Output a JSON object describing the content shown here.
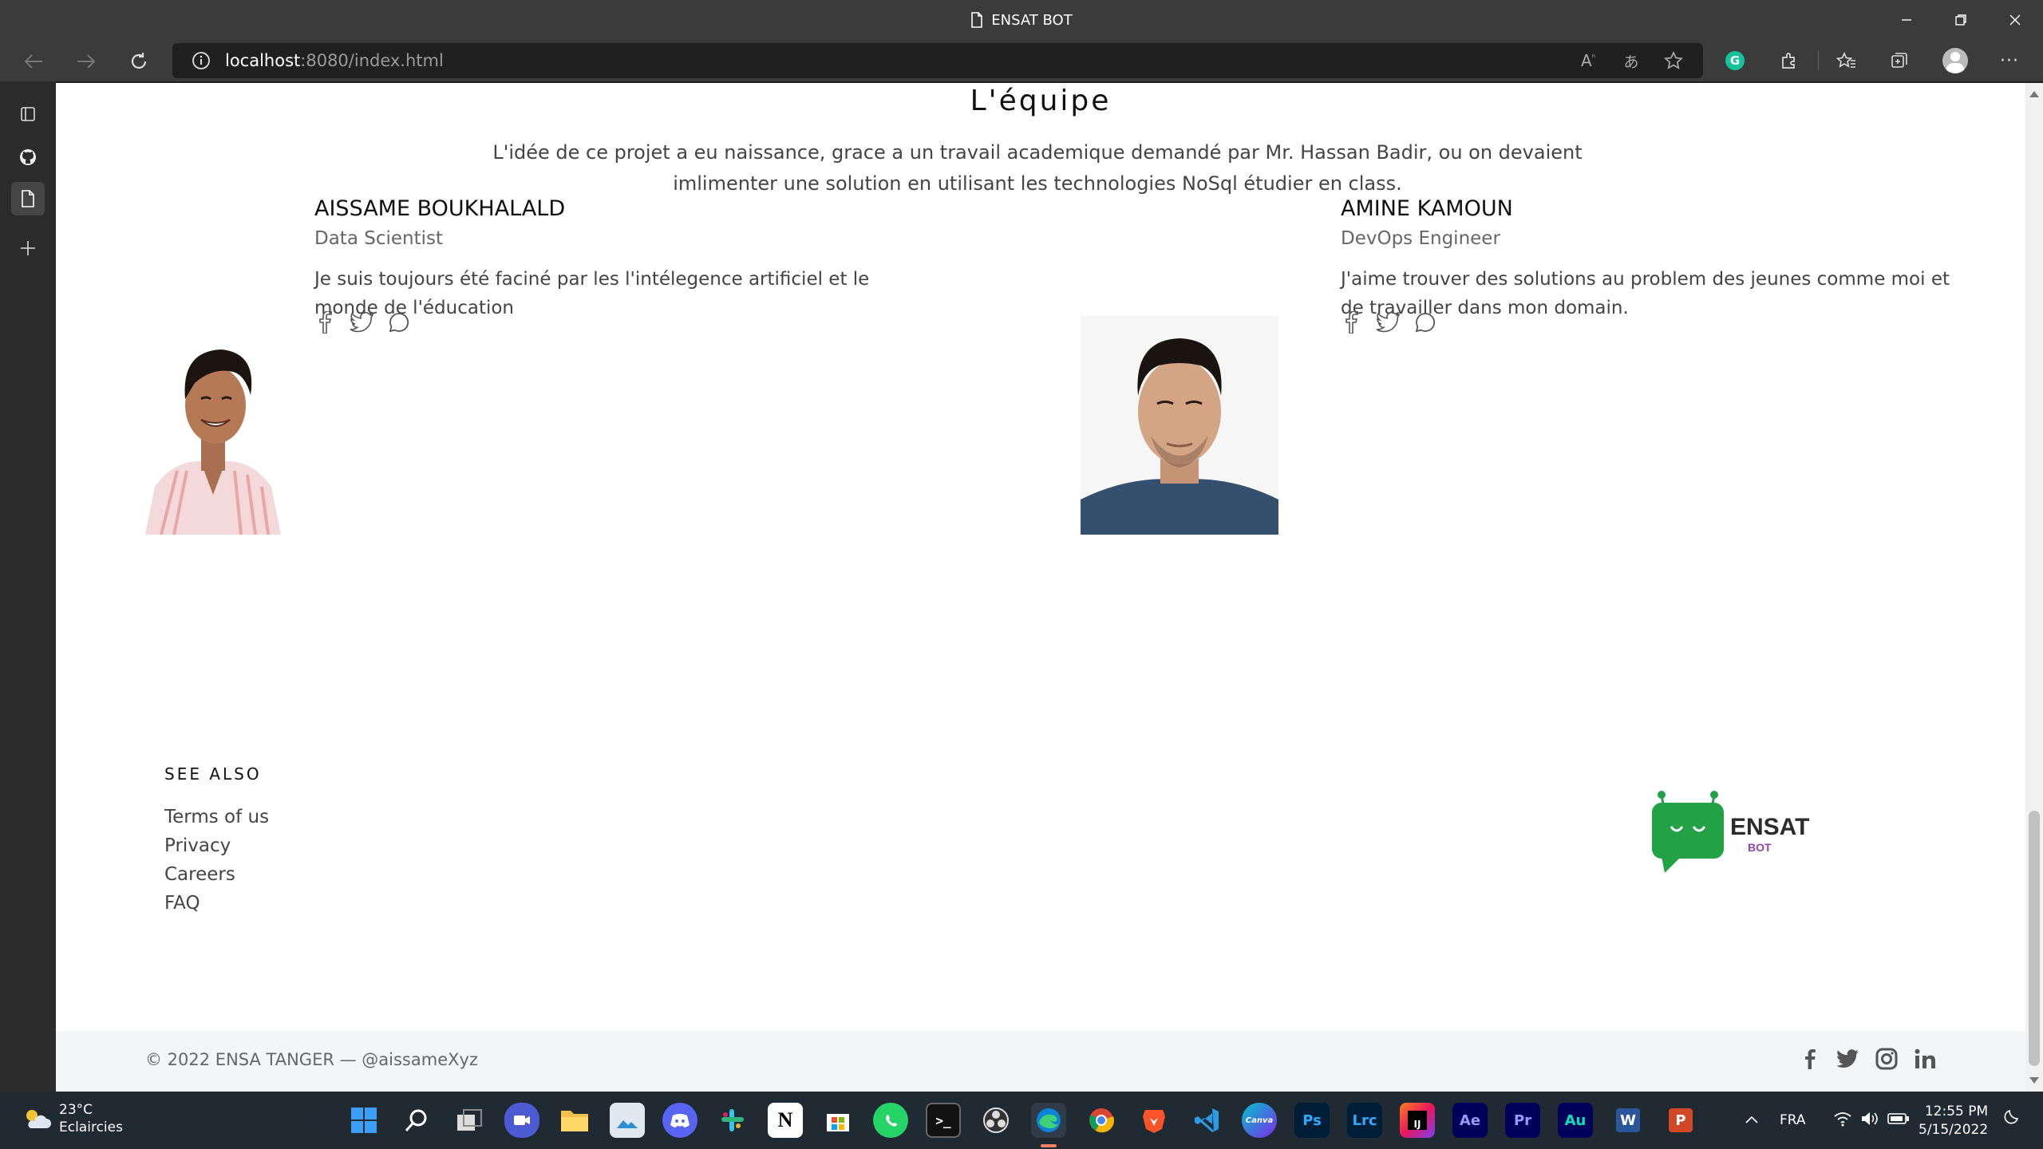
{
  "browser": {
    "window_title": "ENSAT BOT",
    "url_host": "localhost",
    "url_rest": ":8080/index.html"
  },
  "team": {
    "title": "L'équipe",
    "description": "L'idée de ce projet a eu naissance, grace a un travail academique demandé par Mr. Hassan Badir, ou on devaient imlimenter une solution en utilisant les technologies NoSql étudier en class.",
    "members": [
      {
        "name": "AISSAME BOUKHALALD",
        "role": "Data Scientist",
        "bio": "Je suis toujours été faciné par les l'intélegence artificiel et le monde de l'éducation"
      },
      {
        "name": "AMINE KAMOUN",
        "role": "DevOps Engineer",
        "bio": "J'aime trouver des solutions au problem des jeunes comme moi et de travailler dans mon domain."
      }
    ]
  },
  "footer": {
    "see_also_title": "SEE ALSO",
    "links": [
      "Terms of us",
      "Privacy",
      "Careers",
      "FAQ"
    ],
    "logo_main": "ENSAT",
    "logo_sub": "BOT",
    "copyright": "© 2022 ENSA TANGER —  @aissameXyz"
  },
  "taskbar": {
    "temperature": "23°C",
    "weather": "Eclaircies",
    "language": "FRA",
    "time": "12:55 PM",
    "date": "5/15/2022",
    "apps": [
      "Ps",
      "Lrc",
      "Ae",
      "Pr",
      "Au"
    ]
  },
  "colors": {
    "logo_green": "#22a244",
    "logo_purple": "#8e44ad",
    "edge_blue": "#0a84d6"
  }
}
